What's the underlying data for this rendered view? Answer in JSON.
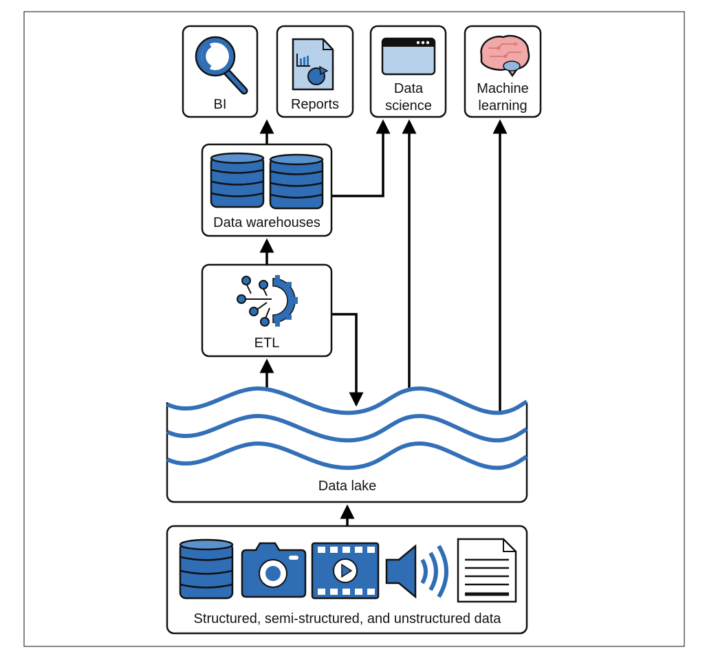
{
  "nodes": {
    "bi": {
      "label": "BI",
      "icon": "magnifier-icon"
    },
    "reports": {
      "label": "Reports",
      "icon": "report-document-icon"
    },
    "data_science": {
      "label_line1": "Data",
      "label_line2": "science",
      "icon": "browser-window-icon"
    },
    "machine_learning": {
      "label_line1": "Machine",
      "label_line2": "learning",
      "icon": "brain-circuit-icon"
    },
    "data_warehouses": {
      "label": "Data warehouses",
      "icon": "database-icon"
    },
    "etl": {
      "label": "ETL",
      "icon": "gear-network-icon"
    },
    "data_lake": {
      "label": "Data lake",
      "icon": "waves-icon"
    },
    "sources": {
      "label": "Structured, semi-structured, and unstructured data",
      "icons": [
        "database-icon",
        "camera-icon",
        "video-icon",
        "speaker-icon",
        "document-icon"
      ]
    }
  },
  "colors": {
    "primary_blue": "#2f6db5",
    "light_blue": "#b7d1ea",
    "brain_pink": "#f0a8a8"
  }
}
